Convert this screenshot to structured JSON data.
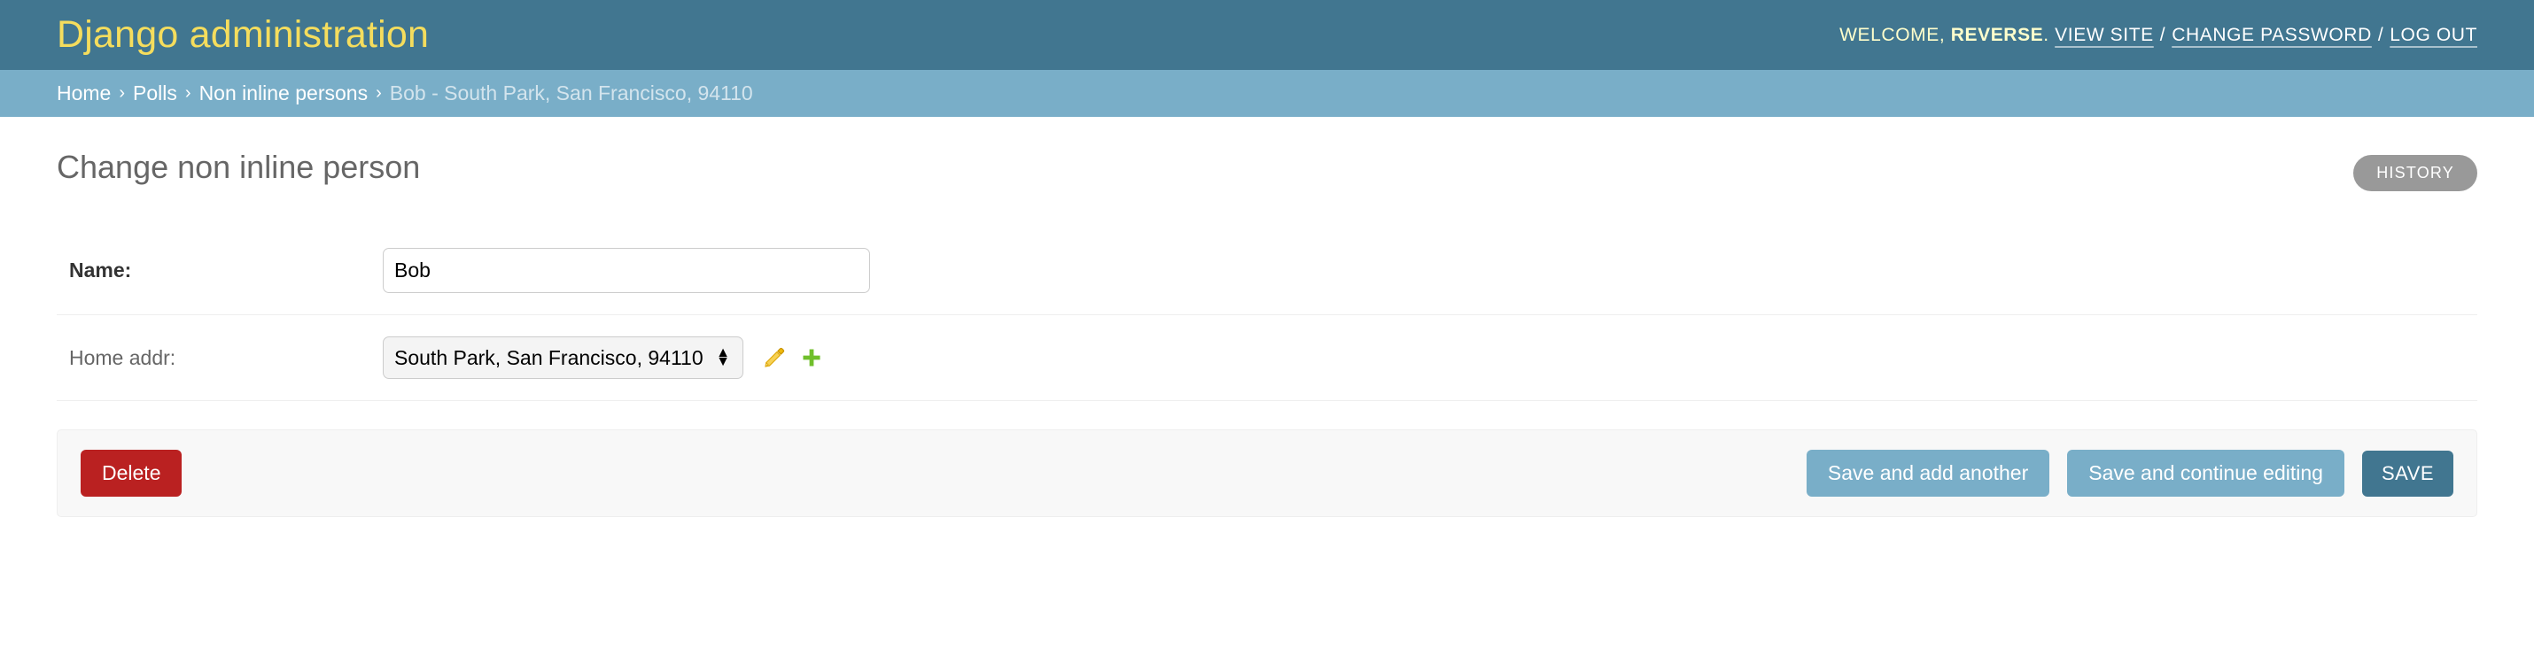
{
  "header": {
    "site_name": "Django administration",
    "user_tools": {
      "welcome_text": "WELCOME,",
      "username": "REVERSE",
      "period": ".",
      "view_site_label": "VIEW SITE",
      "separator": "/",
      "change_password_label": "CHANGE PASSWORD",
      "logout_label": "LOG OUT"
    }
  },
  "breadcrumbs": {
    "separator": "›",
    "items": [
      {
        "label": "Home",
        "current": false
      },
      {
        "label": "Polls",
        "current": false
      },
      {
        "label": "Non inline persons",
        "current": false
      },
      {
        "label": "Bob - South Park, San Francisco, 94110",
        "current": true
      }
    ]
  },
  "main": {
    "page_title": "Change non inline person",
    "history_label": "HISTORY"
  },
  "form": {
    "rows": [
      {
        "label": "Name:",
        "required": true,
        "widget": "text",
        "value": "Bob",
        "placeholder": ""
      },
      {
        "label": "Home addr:",
        "required": false,
        "widget": "select",
        "value": "South Park, San Francisco, 94110",
        "options": [
          "South Park, San Francisco, 94110"
        ],
        "related_icons": [
          "change-related-pencil-icon",
          "add-related-plus-icon"
        ]
      }
    ]
  },
  "submit_row": {
    "delete_label": "Delete",
    "save_add_another_label": "Save and add another",
    "save_continue_label": "Save and continue editing",
    "save_label": "SAVE"
  },
  "colors": {
    "header_bg": "#417690",
    "breadcrumb_bg": "#79aec8",
    "brand_text": "#f5dd5d",
    "delete_red": "#ba2121",
    "button_light_blue": "#79aec8",
    "button_dark_teal": "#417690",
    "history_gray": "#999999",
    "pencil_icon": "#efb80b",
    "plus_icon": "#70bf2b"
  }
}
